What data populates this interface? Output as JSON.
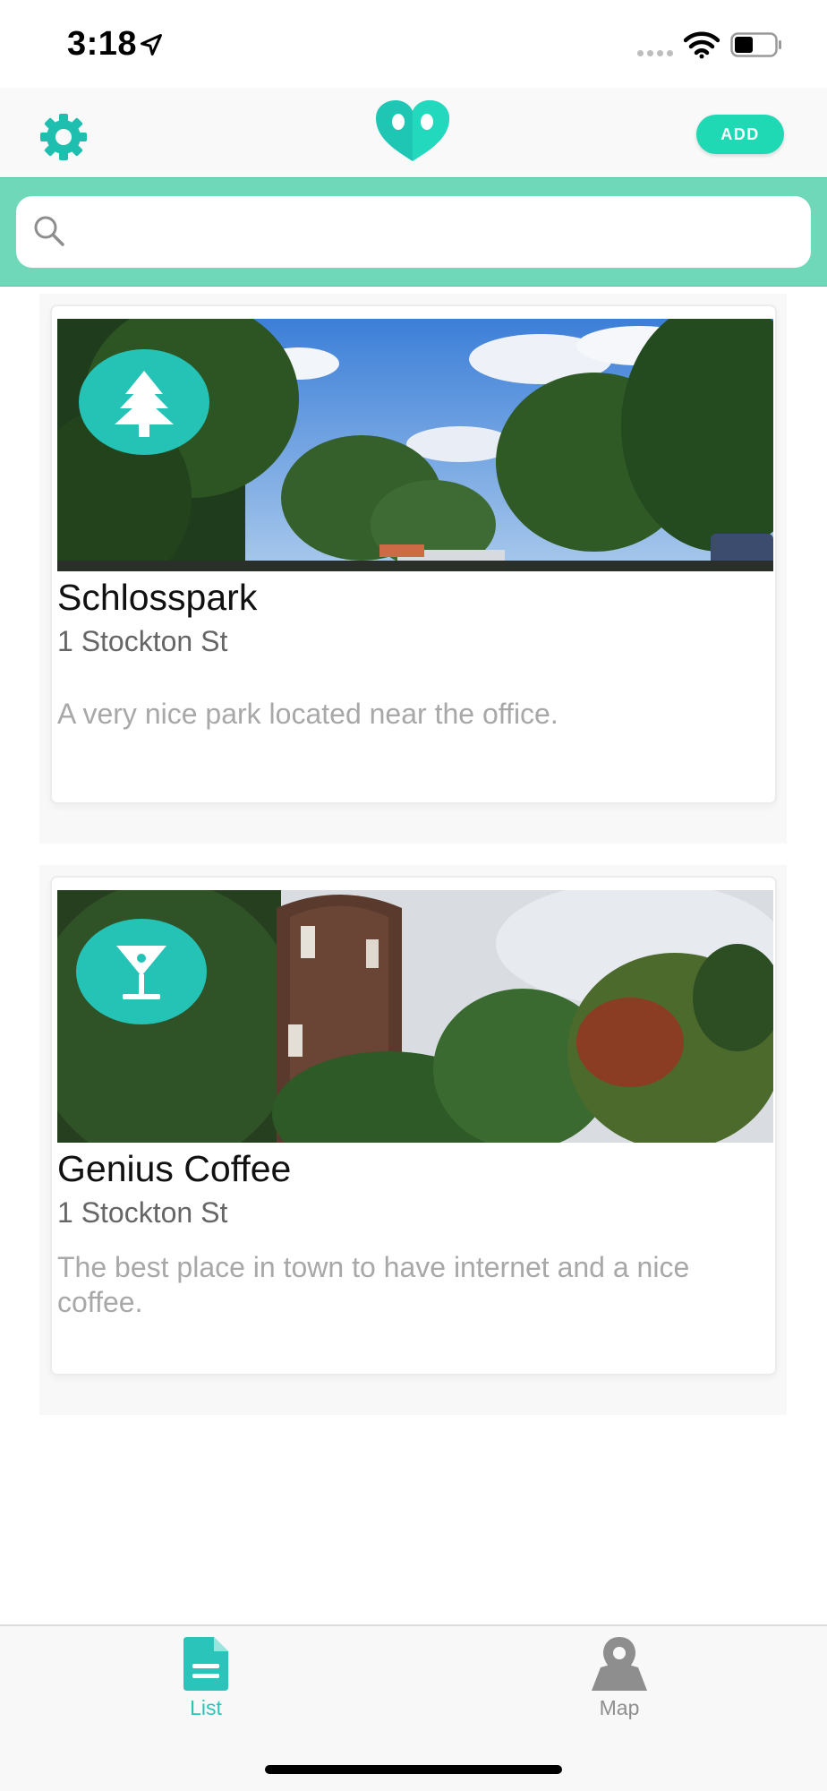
{
  "status_bar": {
    "time": "3:18",
    "icons": [
      "location-arrow-icon",
      "cellular-signal-icon",
      "wifi-icon",
      "battery-icon"
    ]
  },
  "header": {
    "settings_icon": "gear-icon",
    "logo_icon": "heart-logo-icon",
    "add_label": "ADD"
  },
  "search": {
    "placeholder": "",
    "value": ""
  },
  "places": [
    {
      "title": "Schlosspark",
      "address": "1 Stockton St",
      "description": "A very nice park located near the office.",
      "category_icon": "tree-icon"
    },
    {
      "title": "Genius Coffee",
      "address": "1 Stockton St",
      "description": "The best place in town to have internet and a nice coffee.",
      "category_icon": "cocktail-icon"
    }
  ],
  "tabs": [
    {
      "label": "List",
      "icon": "list-document-icon",
      "active": true
    },
    {
      "label": "Map",
      "icon": "map-pin-icon",
      "active": false
    }
  ],
  "colors": {
    "accent": "#1fd8b4",
    "search_band": "#6fd8b8",
    "badge": "#24c3b5",
    "tab_active": "#2bc4bb",
    "tab_inactive": "#8e8e8e"
  }
}
